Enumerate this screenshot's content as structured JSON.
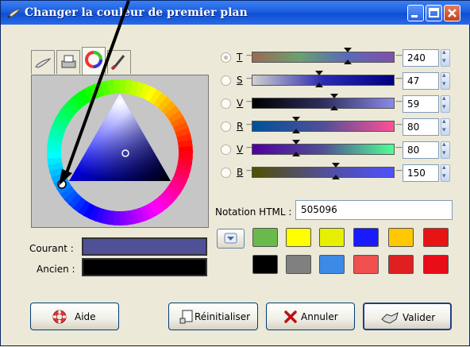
{
  "window": {
    "title": "Changer la couleur de premier plan"
  },
  "tabs": [
    {
      "name": "scales-tab-icon"
    },
    {
      "name": "cmyk-tab-icon"
    },
    {
      "name": "wheel-tab-icon"
    },
    {
      "name": "watercolor-tab-icon"
    }
  ],
  "sliders": [
    {
      "label": "T",
      "value": "240",
      "position": 0.67,
      "selected": true,
      "colors": [
        "#9b6a55",
        "#6aa070",
        "#5a6ab8",
        "#8050a8"
      ]
    },
    {
      "label": "S",
      "value": "47",
      "position": 0.47,
      "selected": false,
      "colors": [
        "#d0d0d0",
        "#2b2bb0",
        "#000080"
      ]
    },
    {
      "label": "V",
      "value": "59",
      "position": 0.58,
      "selected": false,
      "colors": [
        "#000000",
        "#2e2e60",
        "#8a8ae8"
      ]
    },
    {
      "label": "R",
      "value": "80",
      "position": 0.31,
      "selected": false,
      "colors": [
        "#00509a",
        "#505096",
        "#ff5096"
      ]
    },
    {
      "label": "V",
      "value": "80",
      "position": 0.31,
      "selected": false,
      "colors": [
        "#5000a0",
        "#505096",
        "#50ff96"
      ]
    },
    {
      "label": "B",
      "value": "150",
      "position": 0.59,
      "selected": false,
      "colors": [
        "#505000",
        "#505096",
        "#5050ff"
      ]
    }
  ],
  "html_notation": {
    "label": "Notation HTML :",
    "value": "505096"
  },
  "history": {
    "row1": [
      "#6ab94c",
      "#ffff00",
      "#e6f000",
      "#1a1aff",
      "#ffc800",
      "#e81414"
    ],
    "row2": [
      "#000000",
      "#808080",
      "#3c8ae6",
      "#f05050",
      "#e02020",
      "#e80d17"
    ]
  },
  "current": {
    "label": "Courant :",
    "color": "#505096"
  },
  "old": {
    "label": "Ancien :",
    "color": "#000000"
  },
  "buttons": {
    "help": "Aide",
    "reset": "Réinitialiser",
    "cancel": "Annuler",
    "ok": "Valider"
  }
}
